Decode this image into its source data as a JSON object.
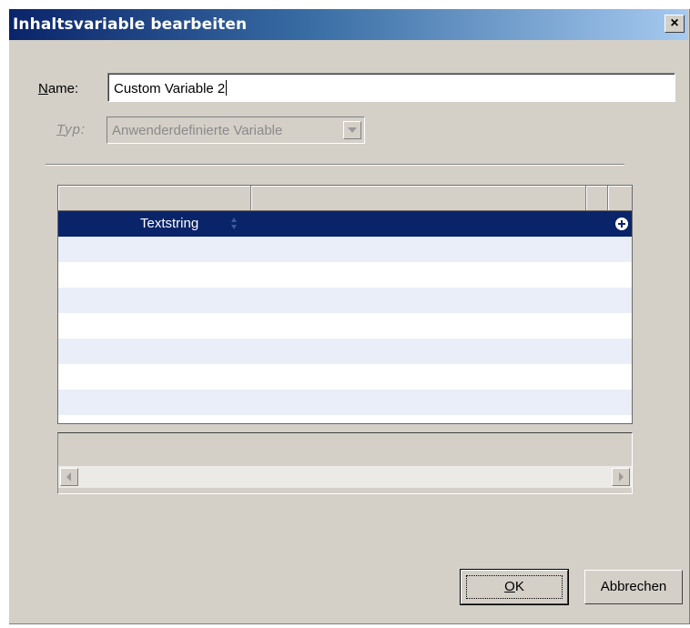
{
  "dialog": {
    "title": "Inhaltsvariable bearbeiten",
    "close_label": "×"
  },
  "fields": {
    "name_label_accel": "N",
    "name_label_rest": "ame:",
    "name_value": "Custom Variable 2",
    "type_label_accel": "T",
    "type_label_rest": "yp:",
    "type_value": "Anwenderdefinierte Variable"
  },
  "grid": {
    "rows": [
      {
        "label": "Textstring",
        "selected": true
      },
      {
        "label": ""
      },
      {
        "label": ""
      },
      {
        "label": ""
      },
      {
        "label": ""
      },
      {
        "label": ""
      },
      {
        "label": ""
      },
      {
        "label": ""
      }
    ]
  },
  "buttons": {
    "ok_accel": "O",
    "ok_rest": "K",
    "cancel_label": "Abbrechen"
  },
  "colors": {
    "titlebar_start": "#0a246a",
    "titlebar_end": "#a6caf0",
    "selection": "#0a246a",
    "row_alt": "#e9eef8",
    "dialog_face": "#d4d0c8"
  },
  "icons": [
    "close-icon",
    "dropdown-arrow-icon",
    "sort-icon",
    "add-icon",
    "scroll-left-icon",
    "scroll-right-icon"
  ]
}
